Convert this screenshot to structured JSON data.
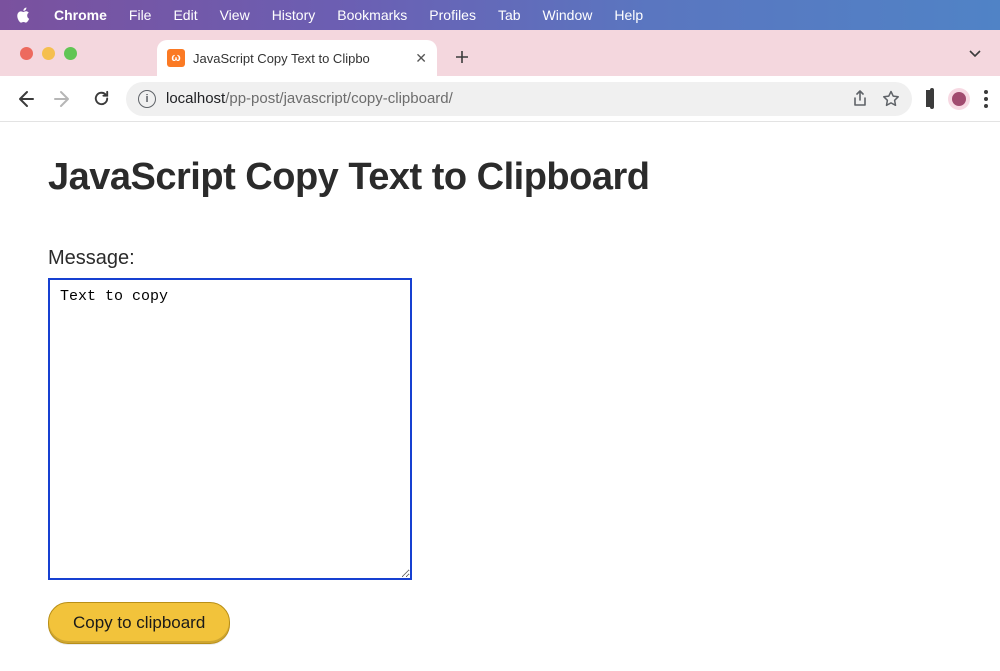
{
  "mac_menu": {
    "app": "Chrome",
    "items": [
      "File",
      "Edit",
      "View",
      "History",
      "Bookmarks",
      "Profiles",
      "Tab",
      "Window",
      "Help"
    ]
  },
  "tab": {
    "title": "JavaScript Copy Text to Clipbo",
    "favicon_letter": "ω"
  },
  "omnibox": {
    "host": "localhost",
    "path": "/pp-post/javascript/copy-clipboard/"
  },
  "page": {
    "heading": "JavaScript Copy Text to Clipboard",
    "message_label": "Message:",
    "message_value": "Text to copy",
    "copy_button": "Copy to clipboard"
  }
}
